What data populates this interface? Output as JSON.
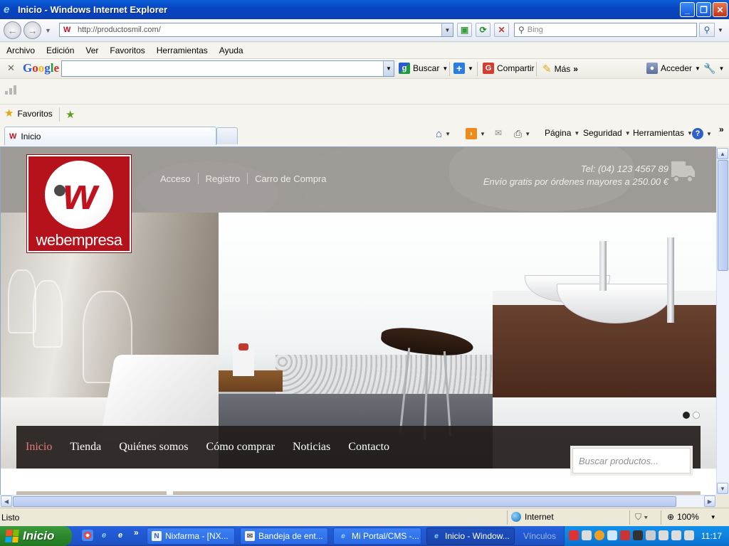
{
  "window": {
    "title": "Inicio - Windows Internet Explorer"
  },
  "address": {
    "url": "http://productosmil.com/",
    "search_placeholder": "Bing"
  },
  "menu": [
    "Archivo",
    "Edición",
    "Ver",
    "Favoritos",
    "Herramientas",
    "Ayuda"
  ],
  "google_toolbar": {
    "logo": "Google",
    "search_label": "Buscar",
    "share_label": "Compartir",
    "more_label": "Más",
    "signin_label": "Acceder"
  },
  "favorites": {
    "label": "Favoritos"
  },
  "tab": {
    "label": "Inicio"
  },
  "commands": {
    "page": "Página",
    "security": "Seguridad",
    "tools": "Herramientas"
  },
  "site": {
    "brand": "webempresa",
    "top_links": [
      "Acceso",
      "Registro",
      "Carro de Compra"
    ],
    "phone": "Tel: (04) 123 4567 89",
    "shipping": "Envío gratis por órdenes mayores a 250.00 €",
    "nav": [
      "Inicio",
      "Tienda",
      "Quiénes somos",
      "Cómo comprar",
      "Noticias",
      "Contacto"
    ],
    "nav_active_index": 0,
    "product_search_placeholder": "Buscar productos...",
    "slider_dots": 2,
    "slider_active_dot": 0
  },
  "status": {
    "text": "Listo",
    "zone": "Internet",
    "zoom": "100%"
  },
  "taskbar": {
    "start": "Inicio",
    "buttons": [
      "Nixfarma - [NX...",
      "Bandeja de ent...",
      "Mi Portal/CMS -...",
      "Inicio - Window..."
    ],
    "active_index": 3,
    "links_label": "Vínculos",
    "clock": "11:17"
  },
  "colors": {
    "titlebar": "#0a53d6",
    "brand_red": "#b5121b",
    "nav_active": "#e8797a",
    "nav_bg": "#231d1b",
    "header_bg": "#9e9a96"
  }
}
